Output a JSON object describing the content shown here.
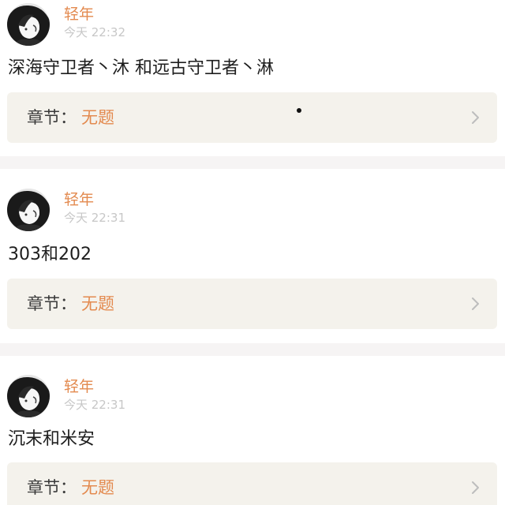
{
  "posts": [
    {
      "username": "轻年",
      "timestamp": "今天 22:32",
      "content": "深海守卫者丶沐 和远古守卫者丶淋",
      "chapter_prefix": "章节：",
      "chapter_title": "无题",
      "avatar_icon": "anime-avatar-icon",
      "chevron_icon": "chevron-right-icon"
    },
    {
      "username": "轻年",
      "timestamp": "今天 22:31",
      "content": "303和202",
      "chapter_prefix": "章节：",
      "chapter_title": "无题",
      "avatar_icon": "anime-avatar-icon",
      "chevron_icon": "chevron-right-icon"
    },
    {
      "username": "轻年",
      "timestamp": "今天 22:31",
      "content": "沉末和米安",
      "chapter_prefix": "章节：",
      "chapter_title": "无题",
      "avatar_icon": "anime-avatar-icon",
      "chevron_icon": "chevron-right-icon"
    }
  ],
  "colors": {
    "accent": "#e38a4f",
    "timestamp": "#c7c7c7",
    "card_background": "#f4f2ec",
    "separator": "#f6f4f4",
    "text": "#1e1e1e"
  }
}
